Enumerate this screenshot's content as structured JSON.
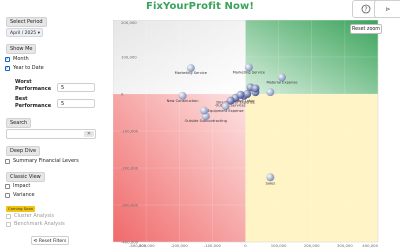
{
  "app": {
    "title": "FixYourProfit Now!"
  },
  "header": {
    "help_icon": "question-circle-icon",
    "play_icon": "play-icon",
    "help_glyph": "?",
    "play_glyph": "⊳"
  },
  "sidebar": {
    "select_period_label": "Select Period",
    "period_value": "April / 2025",
    "show_me_label": "Show Me",
    "month_label": "Month",
    "month_checked": true,
    "ytd_label": "Year to Date",
    "ytd_checked": true,
    "worst_label_1": "Worst",
    "worst_label_2": "Performance",
    "worst_value": "5",
    "best_label_1": "Best",
    "best_label_2": "Performance",
    "best_value": "5",
    "search_label": "Search",
    "search_value": "",
    "search_clear": "✕",
    "deep_dive_label": "Deep Dive",
    "summary_label": "Summary Financial Levers",
    "classic_view_label": "Classic View",
    "impact_label": "Impact",
    "variance_label": "Variance",
    "coming_soon_label": "Coming Soon",
    "cluster_label": "Cluster Analysis",
    "benchmark_label": "Benchmark Analysis",
    "reset_filters_label": "Reset Filters"
  },
  "chart": {
    "reset_zoom_label": "Reset zoom",
    "quadrant_colors": {
      "top_left": "#e6e6e6",
      "top_right": "#3aa35a",
      "bottom_left": "#f06a6a",
      "bottom_right": "#fff4c6"
    }
  },
  "chart_data": {
    "type": "scatter",
    "xlim": [
      -400000,
      400000
    ],
    "ylim": [
      -400000,
      200000
    ],
    "x_ticks": [
      -400000,
      -300000,
      -200000,
      -100000,
      0,
      100000,
      200000,
      300000,
      400000
    ],
    "x_tick_labels": [
      "-400,000",
      "-300,000",
      "-200,000",
      "-100,000",
      "0",
      "100,000",
      "200,000",
      "300,000",
      "400,000"
    ],
    "y_ticks": [
      200000,
      100000,
      0,
      -100000,
      -200000,
      -300000,
      -400000
    ],
    "y_tick_labels": [
      "200,000",
      "100,000",
      "0",
      "-100,000",
      "-200,000",
      "-300,000",
      "-400,000"
    ],
    "points": [
      {
        "label": "Marketing Service",
        "x": -165000,
        "y": 70000
      },
      {
        "label": "Marketing Service",
        "x": 10000,
        "y": 72000
      },
      {
        "label": "Material Expense",
        "x": 110000,
        "y": 45000
      },
      {
        "label": "New Construction",
        "x": -190000,
        "y": -5000
      },
      {
        "label": "Direct Labor",
        "x": -5000,
        "y": -5000
      },
      {
        "label": "Direct Labor Expense",
        "x": -30000,
        "y": -10000
      },
      {
        "label": "Outside Services",
        "x": -45000,
        "y": -18000
      },
      {
        "label": "Equipment Expense",
        "x": -60000,
        "y": -33000
      },
      {
        "label": "Outside Subcontracting",
        "x": -120000,
        "y": -60000
      },
      {
        "label": "",
        "x": -125000,
        "y": -45000
      },
      {
        "label": "",
        "x": 30000,
        "y": 5000
      },
      {
        "label": "",
        "x": 15000,
        "y": 18000
      },
      {
        "label": "",
        "x": 5000,
        "y": 0
      },
      {
        "label": "",
        "x": -15000,
        "y": -2000
      },
      {
        "label": "",
        "x": 75000,
        "y": 5000
      },
      {
        "label": "",
        "x": 30000,
        "y": 15000
      },
      {
        "label": "Sales",
        "x": 75000,
        "y": -225000
      }
    ]
  }
}
